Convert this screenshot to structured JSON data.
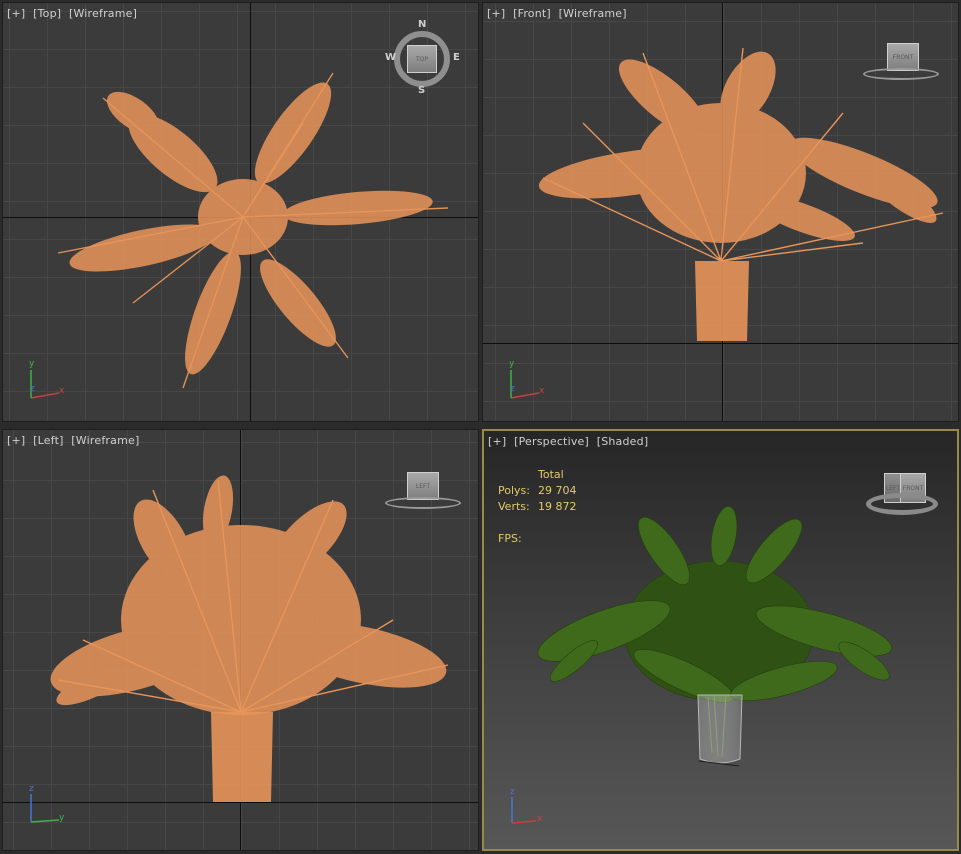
{
  "viewports": {
    "top": {
      "plus": "[+]",
      "view": "[Top]",
      "mode": "[Wireframe]"
    },
    "front": {
      "plus": "[+]",
      "view": "[Front]",
      "mode": "[Wireframe]"
    },
    "left": {
      "plus": "[+]",
      "view": "[Left]",
      "mode": "[Wireframe]"
    },
    "perspective": {
      "plus": "[+]",
      "view": "[Perspective]",
      "mode": "[Shaded]"
    }
  },
  "viewcube": {
    "top_face": "TOP",
    "front_face": "FRONT",
    "left_face": "LEFT",
    "persp_side_face": "LEFT",
    "persp_front_face": "FRONT",
    "compass": {
      "n": "N",
      "s": "S",
      "e": "E",
      "w": "W"
    }
  },
  "axes": {
    "x": "x",
    "y": "y",
    "z": "z"
  },
  "stats": {
    "header": "Total",
    "polys_label": "Polys:",
    "polys_value": "29 704",
    "verts_label": "Verts:",
    "verts_value": "19 872",
    "fps_label": "FPS:"
  },
  "colors": {
    "wireframe": "#e8955a",
    "leaf_shaded": "#3f6a1c",
    "background": "#3b3b3b",
    "active_border": "#9a8a4a",
    "stats_text": "#e3c96b"
  }
}
